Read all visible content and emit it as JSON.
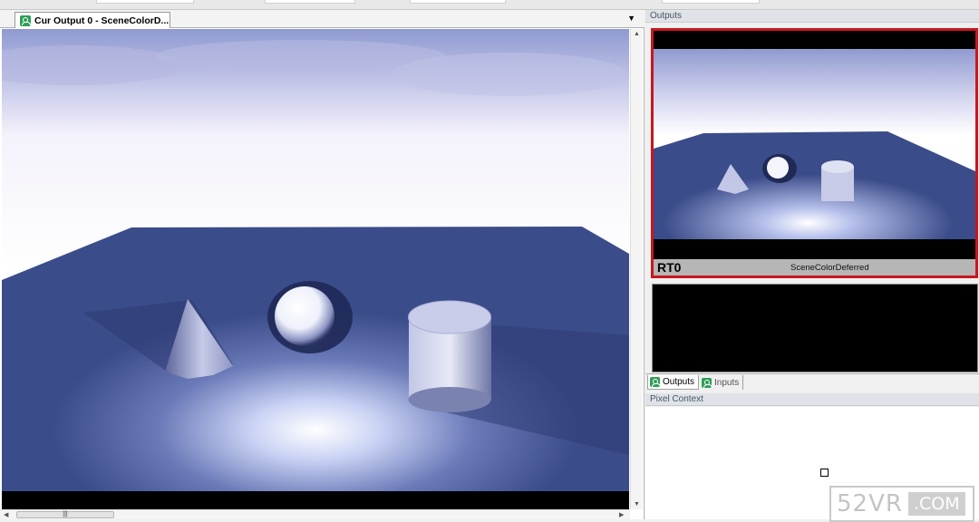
{
  "document": {
    "tab_title": "Cur Output 0 - SceneColorD...",
    "dropdown_glyph": "▼",
    "hscroll_grip": "|||"
  },
  "scene": {
    "sky_color": "#9ea8d8",
    "plane_color": "#3b4c8a",
    "objects": [
      "cone",
      "sphere",
      "cylinder"
    ]
  },
  "outputs_panel": {
    "title": "Outputs",
    "selected_border_color": "#c8171e",
    "render_target": {
      "label": "RT0",
      "name": "SceneColorDeferred"
    }
  },
  "bottom_tabs": [
    {
      "label": "Outputs",
      "active": true
    },
    {
      "label": "Inputs",
      "active": false
    }
  ],
  "pixel_context": {
    "title": "Pixel Context"
  },
  "watermark": {
    "text": "52VR",
    "suffix": ".COM"
  }
}
